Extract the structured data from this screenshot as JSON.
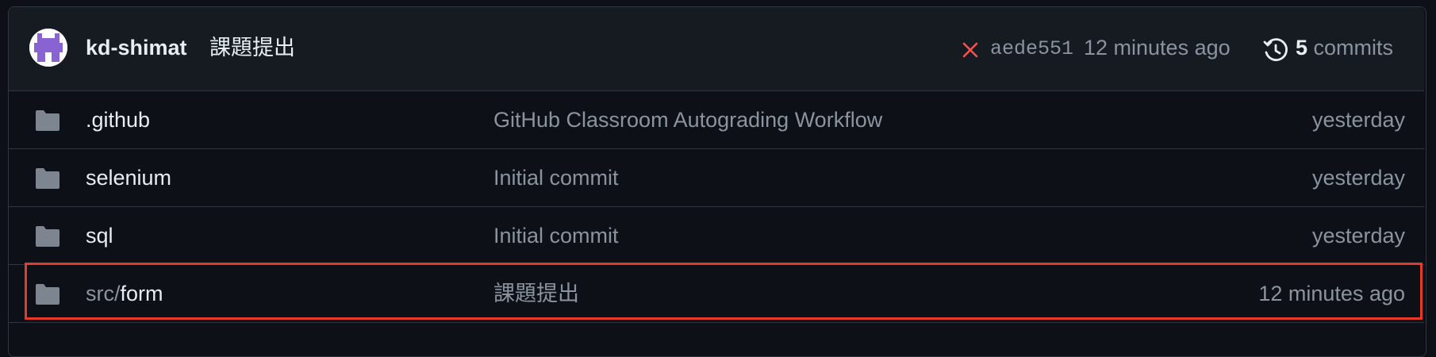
{
  "latest_commit": {
    "author": "kd-shimat",
    "message": "課題提出",
    "status_icon": "x-icon",
    "status_color": "#f85149",
    "sha": "aede551",
    "time": "12 minutes ago",
    "history_icon": "history-icon",
    "commit_count": "5",
    "commits_label": " commits"
  },
  "files": [
    {
      "type": "folder",
      "name_prefix": "",
      "name": ".github",
      "message": "GitHub Classroom Autograding Workflow",
      "time": "yesterday"
    },
    {
      "type": "folder",
      "name_prefix": "",
      "name": "selenium",
      "message": "Initial commit",
      "time": "yesterday"
    },
    {
      "type": "folder",
      "name_prefix": "",
      "name": "sql",
      "message": "Initial commit",
      "time": "yesterday"
    },
    {
      "type": "folder",
      "name_prefix": "src/",
      "name": "form",
      "message": "課題提出",
      "time": "12 minutes ago"
    }
  ],
  "colors": {
    "background": "#0d1117",
    "header": "#161b22",
    "border": "#30363d",
    "text_primary": "#e6edf3",
    "text_muted": "#8b949e",
    "folder_icon": "#7d8590",
    "highlight_box": "#e5392a"
  }
}
